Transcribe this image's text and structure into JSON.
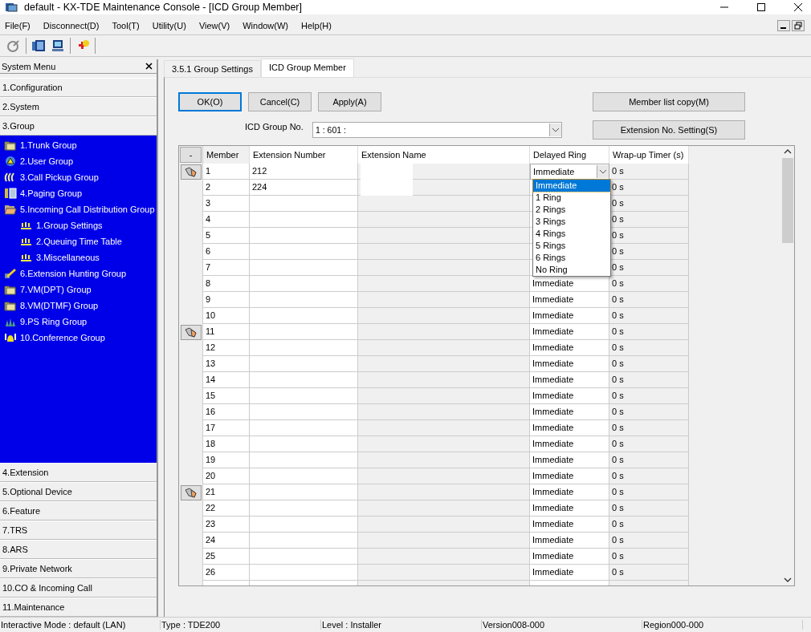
{
  "window": {
    "title": "default - KX-TDE Maintenance Console - [ICD Group Member]"
  },
  "menu": [
    "File(F)",
    "Disconnect(D)",
    "Tool(T)",
    "Utility(U)",
    "View(V)",
    "Window(W)",
    "Help(H)"
  ],
  "sidebar": {
    "title": "System Menu",
    "sections": [
      {
        "label": "1.Configuration"
      },
      {
        "label": "2.System"
      },
      {
        "label": "3.Group",
        "expanded": true,
        "children": [
          {
            "label": "1.Trunk Group"
          },
          {
            "label": "2.User Group"
          },
          {
            "label": "3.Call Pickup Group"
          },
          {
            "label": "4.Paging Group"
          },
          {
            "label": "5.Incoming Call Distribution Group",
            "expanded": true,
            "children": [
              {
                "label": "1.Group Settings"
              },
              {
                "label": "2.Queuing Time Table"
              },
              {
                "label": "3.Miscellaneous"
              }
            ]
          },
          {
            "label": "6.Extension Hunting Group"
          },
          {
            "label": "7.VM(DPT) Group"
          },
          {
            "label": "8.VM(DTMF) Group"
          },
          {
            "label": "9.PS Ring Group"
          },
          {
            "label": "10.Conference Group"
          }
        ]
      },
      {
        "label": "4.Extension"
      },
      {
        "label": "5.Optional Device"
      },
      {
        "label": "6.Feature"
      },
      {
        "label": "7.TRS"
      },
      {
        "label": "8.ARS"
      },
      {
        "label": "9.Private Network"
      },
      {
        "label": "10.CO & Incoming Call"
      },
      {
        "label": "11.Maintenance"
      }
    ]
  },
  "tabs": [
    {
      "label": "3.5.1 Group Settings",
      "selected": false
    },
    {
      "label": "ICD Group Member",
      "selected": true
    }
  ],
  "buttons": {
    "ok": "OK(O)",
    "cancel": "Cancel(C)",
    "apply": "Apply(A)",
    "member_copy": "Member list copy(M)",
    "extension_setting": "Extension No. Setting(S)"
  },
  "group_no": {
    "label": "ICD Group No.",
    "value": "1 : 601 :"
  },
  "grid": {
    "corner": "-",
    "columns": [
      "Member",
      "Extension Number",
      "Extension Name",
      "Delayed Ring",
      "Wrap-up Timer (s)"
    ],
    "rows": [
      {
        "member": "1",
        "ext_number": "212",
        "delayed_ring": "Immediate",
        "wrapup": "0 s",
        "marker": true,
        "expanded": true,
        "options": [
          {
            "label": "Immediate",
            "selected": true
          },
          {
            "label": "1 Ring",
            "selected": false
          },
          {
            "label": "2 Rings",
            "selected": false
          },
          {
            "label": "3 Rings",
            "selected": false
          },
          {
            "label": "4 Rings",
            "selected": false
          },
          {
            "label": "5 Rings",
            "selected": false
          },
          {
            "label": "6 Rings",
            "selected": false
          },
          {
            "label": "No Ring",
            "selected": false
          }
        ]
      },
      {
        "member": "2",
        "ext_number": "224",
        "wrapup": "0 s",
        "marker": false
      },
      {
        "member": "3",
        "wrapup": "0 s",
        "marker": false
      },
      {
        "member": "4",
        "wrapup": "0 s",
        "marker": false
      },
      {
        "member": "5",
        "wrapup": "0 s",
        "marker": false
      },
      {
        "member": "6",
        "wrapup": "0 s",
        "marker": false
      },
      {
        "member": "7",
        "wrapup": "0 s",
        "marker": false
      },
      {
        "member": "8",
        "delayed_ring": "Immediate",
        "wrapup": "0 s",
        "marker": false
      },
      {
        "member": "9",
        "delayed_ring": "Immediate",
        "wrapup": "0 s",
        "marker": false
      },
      {
        "member": "10",
        "delayed_ring": "Immediate",
        "wrapup": "0 s",
        "marker": false
      },
      {
        "member": "11",
        "delayed_ring": "Immediate",
        "wrapup": "0 s",
        "marker": true
      },
      {
        "member": "12",
        "delayed_ring": "Immediate",
        "wrapup": "0 s",
        "marker": false
      },
      {
        "member": "13",
        "delayed_ring": "Immediate",
        "wrapup": "0 s",
        "marker": false
      },
      {
        "member": "14",
        "delayed_ring": "Immediate",
        "wrapup": "0 s",
        "marker": false
      },
      {
        "member": "15",
        "delayed_ring": "Immediate",
        "wrapup": "0 s",
        "marker": false
      },
      {
        "member": "16",
        "delayed_ring": "Immediate",
        "wrapup": "0 s",
        "marker": false
      },
      {
        "member": "17",
        "delayed_ring": "Immediate",
        "wrapup": "0 s",
        "marker": false
      },
      {
        "member": "18",
        "delayed_ring": "Immediate",
        "wrapup": "0 s",
        "marker": false
      },
      {
        "member": "19",
        "delayed_ring": "Immediate",
        "wrapup": "0 s",
        "marker": false
      },
      {
        "member": "20",
        "delayed_ring": "Immediate",
        "wrapup": "0 s",
        "marker": false
      },
      {
        "member": "21",
        "delayed_ring": "Immediate",
        "wrapup": "0 s",
        "marker": true
      },
      {
        "member": "22",
        "delayed_ring": "Immediate",
        "wrapup": "0 s",
        "marker": false
      },
      {
        "member": "23",
        "delayed_ring": "Immediate",
        "wrapup": "0 s",
        "marker": false
      },
      {
        "member": "24",
        "delayed_ring": "Immediate",
        "wrapup": "0 s",
        "marker": false
      },
      {
        "member": "25",
        "delayed_ring": "Immediate",
        "wrapup": "0 s",
        "marker": false
      },
      {
        "member": "26",
        "delayed_ring": "Immediate",
        "wrapup": "0 s",
        "marker": false
      }
    ]
  },
  "status_bar": [
    "Interactive Mode : default (LAN)",
    "Type : TDE200",
    "Level : Installer",
    "Version008-000",
    "Region000-000"
  ]
}
